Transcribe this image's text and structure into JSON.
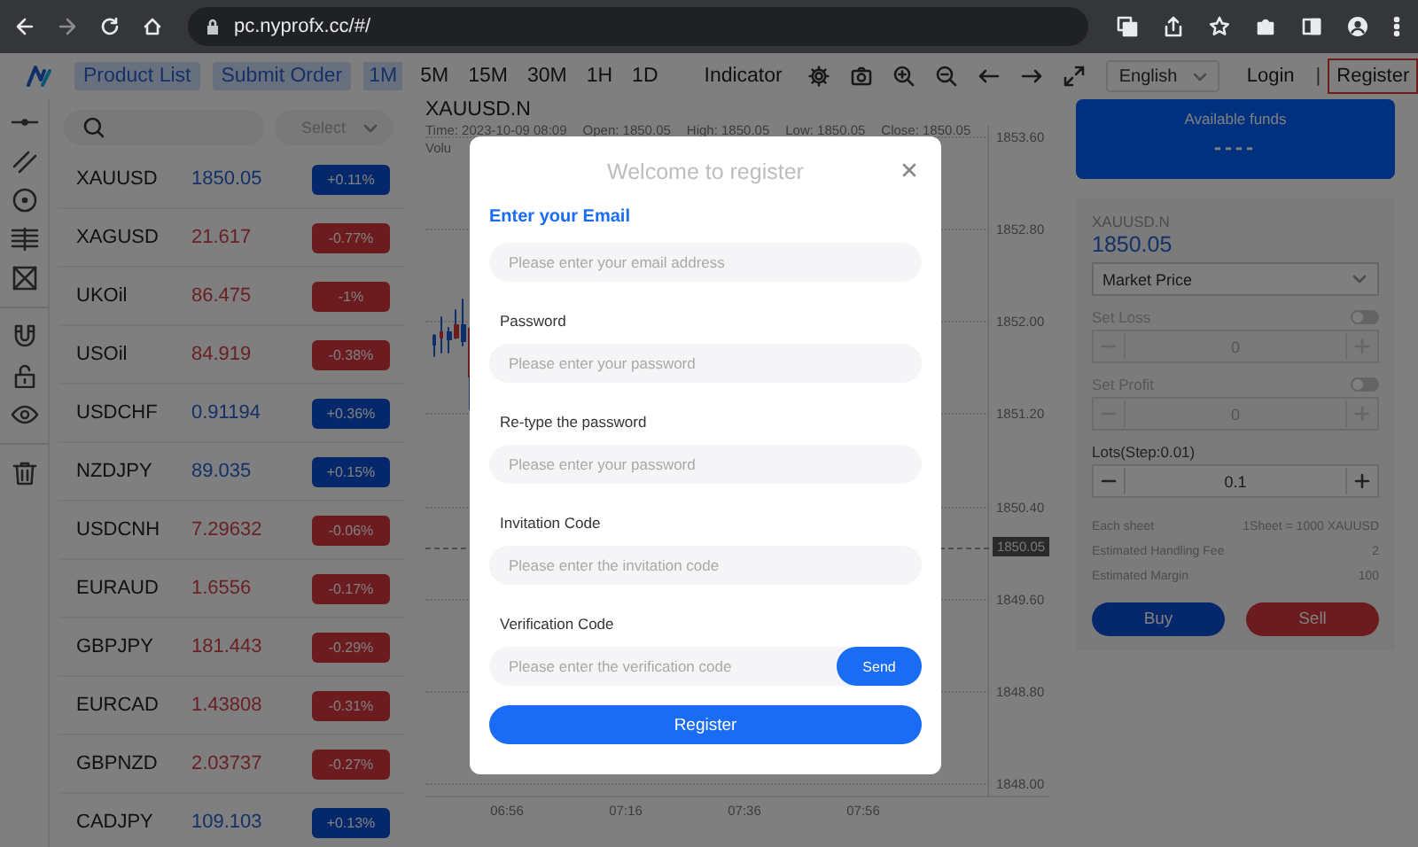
{
  "browser": {
    "url": "pc.nyprofx.cc/#/"
  },
  "toolbar": {
    "nav": [
      {
        "label": "Product List"
      },
      {
        "label": "Submit Order"
      }
    ],
    "intervals": [
      {
        "label": "1M",
        "selected": true
      },
      {
        "label": "5M",
        "selected": false
      },
      {
        "label": "15M",
        "selected": false
      },
      {
        "label": "30M",
        "selected": false
      },
      {
        "label": "1H",
        "selected": false
      },
      {
        "label": "1D",
        "selected": false
      }
    ],
    "indicator": "Indicator",
    "language": "English",
    "login": "Login",
    "separator": "|",
    "register": "Register"
  },
  "products": {
    "filter": {
      "placeholder": "Select"
    },
    "rows": [
      {
        "symbol": "XAUUSD",
        "price": "1850.05",
        "change": "+0.11%",
        "kind": "up"
      },
      {
        "symbol": "XAGUSD",
        "price": "21.617",
        "change": "-0.77%",
        "kind": "down"
      },
      {
        "symbol": "UKOil",
        "price": "86.475",
        "change": "-1%",
        "kind": "down"
      },
      {
        "symbol": "USOil",
        "price": "84.919",
        "change": "-0.38%",
        "kind": "down"
      },
      {
        "symbol": "USDCHF",
        "price": "0.91194",
        "change": "+0.36%",
        "kind": "up"
      },
      {
        "symbol": "NZDJPY",
        "price": "89.035",
        "change": "+0.15%",
        "kind": "up"
      },
      {
        "symbol": "USDCNH",
        "price": "7.29632",
        "change": "-0.06%",
        "kind": "down"
      },
      {
        "symbol": "EURAUD",
        "price": "1.6556",
        "change": "-0.17%",
        "kind": "down"
      },
      {
        "symbol": "GBPJPY",
        "price": "181.443",
        "change": "-0.29%",
        "kind": "down"
      },
      {
        "symbol": "EURCAD",
        "price": "1.43808",
        "change": "-0.31%",
        "kind": "down"
      },
      {
        "symbol": "GBPNZD",
        "price": "2.03737",
        "change": "-0.27%",
        "kind": "down"
      },
      {
        "symbol": "CADJPY",
        "price": "109.103",
        "change": "+0.13%",
        "kind": "up"
      }
    ]
  },
  "chart": {
    "symbol": "XAUUSD.N",
    "info": [
      "Time: 2023-10-09 08:09",
      "Open: 1850.05",
      "High: 1850.05",
      "Low: 1850.05",
      "Close: 1850.05"
    ],
    "volume": "Volu",
    "y_labels": [
      "1853.60",
      "1852.80",
      "1852.00",
      "1851.20",
      "1850.40",
      "1849.60",
      "1848.80",
      "1848.00"
    ],
    "price_tag": "1850.05",
    "x_labels": [
      "06:56",
      "07:16",
      "07:36",
      "07:56"
    ]
  },
  "order_panel": {
    "funds_label": "Available funds",
    "funds_value": "----",
    "symbol": "XAUUSD.N",
    "price": "1850.05",
    "order_type": "Market Price",
    "stop_loss": {
      "label": "Set Loss",
      "on": false,
      "value": "0"
    },
    "take_profit": {
      "label": "Set Profit",
      "on": false,
      "value": "0"
    },
    "lots": {
      "label": "Lots(Step:0.01)",
      "value": "0.1"
    },
    "details": [
      {
        "label": "Each sheet",
        "value": "1Sheet = 1000 XAUUSD"
      },
      {
        "label": "Estimated Handling Fee",
        "value": "2"
      },
      {
        "label": "Estimated Margin",
        "value": "100"
      }
    ],
    "buttons": [
      {
        "label": "Buy",
        "kind": "buy"
      },
      {
        "label": "Sell",
        "kind": "sell"
      }
    ]
  },
  "modal": {
    "title": "Welcome to register",
    "heading": "Enter your Email",
    "fields": [
      {
        "placeholder": "Please enter your email address"
      },
      {
        "label": "Password",
        "placeholder": "Please enter your password"
      },
      {
        "label": "Re-type the password",
        "placeholder": "Please enter your password"
      },
      {
        "label": "Invitation Code",
        "placeholder": "Please enter the invitation code"
      },
      {
        "label": "Verification Code",
        "placeholder": "Please enter the verification code",
        "action": "Send"
      }
    ],
    "submit": "Register"
  }
}
